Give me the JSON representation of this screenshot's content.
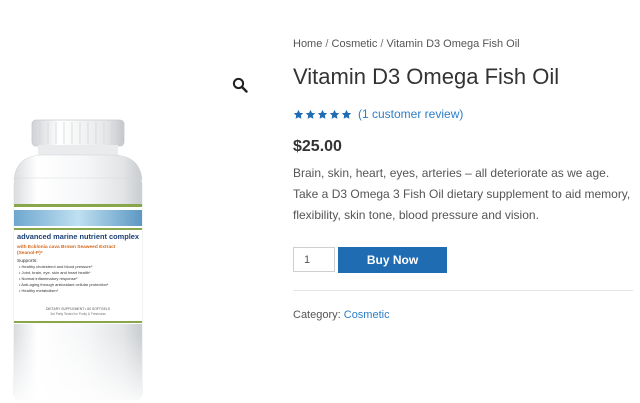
{
  "breadcrumb": {
    "home": "Home",
    "separator": " / ",
    "category": "Cosmetic",
    "current": "Vitamin D3 Omega Fish Oil"
  },
  "product": {
    "title": "Vitamin D3 Omega Fish Oil",
    "rating": 5,
    "rating_max": 5,
    "review_link": "(1 customer review)",
    "price": "$25.00",
    "description": "Brain, skin, heart, eyes, arteries – all deteriorate as we age. Take a D3 Omega 3 Fish Oil dietary supplement to aid memory, flexibility, skin tone, blood pressure and vision.",
    "quantity": "1",
    "buy_label": "Buy Now",
    "category_label": "Category: ",
    "category_value": "Cosmetic"
  },
  "label": {
    "headline": "advanced marine nutrient complex",
    "subline_1": "with Ecklonia cava Brown Seaweed Extract",
    "subline_2": "(Seanol-P)*",
    "supports": "Supports:",
    "bullets": [
      "• Healthy cholesterol and blood pressure*",
      "• Joint, brain, eye, skin and heart health*",
      "• Normal inflammatory response*",
      "• Anti-aging through antioxidant cellular protection*",
      "• Healthy metabolism*"
    ],
    "footer_1": "DIETARY SUPPLEMENT • 60 SOFTGELS",
    "footer_2": "3rd Party Tested for Purity & Freshness"
  },
  "icons": {
    "zoom": "magnifier-icon",
    "star": "star-icon"
  },
  "colors": {
    "accent": "#1f6cb3",
    "link": "#2c7ec7",
    "star": "#1f6cb3",
    "text": "#333333"
  }
}
